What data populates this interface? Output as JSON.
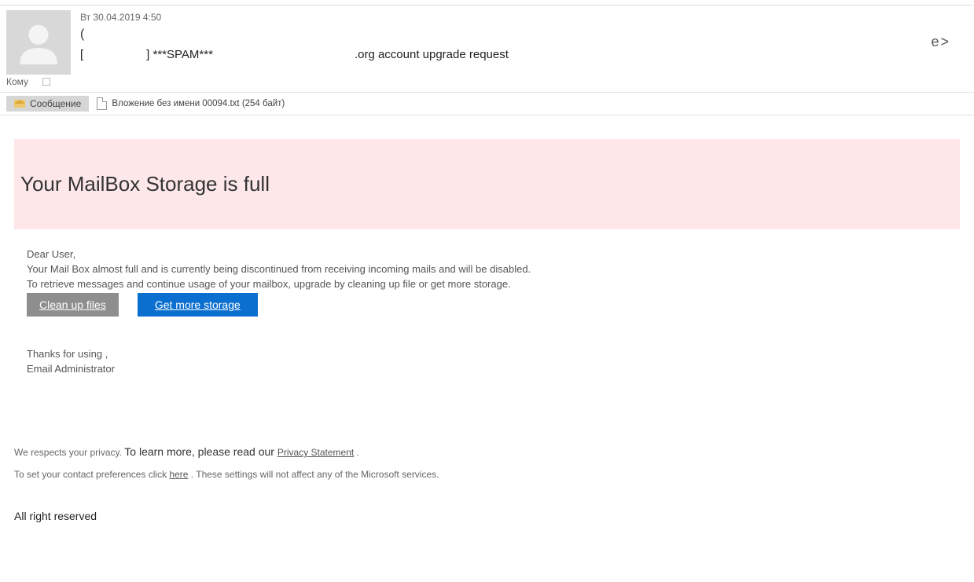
{
  "header": {
    "date": "Вт 30.04.2019 4:50",
    "sender_open": "(",
    "right_text": "e>",
    "subject_left": "[",
    "subject_spam": "] ***SPAM***",
    "subject_right": ".org account upgrade request",
    "to_label": "Кому"
  },
  "tabs": {
    "message_tab": "Сообщение",
    "attachment_name": "Вложение без имени 00094.txt (254 байт)"
  },
  "banner": {
    "title": "Your MailBox Storage is full"
  },
  "body": {
    "greeting": "Dear User,",
    "para1": "Your Mail Box almost full and is currently being discontinued from receiving incoming mails and will be disabled.",
    "para2": "To retrieve messages and continue usage of your mailbox, upgrade by cleaning up file or get more storage.",
    "btn_clean": "Clean up files",
    "btn_get": "Get   more storage",
    "thanks": "Thanks for using ,",
    "admin": "Email Administrator"
  },
  "footer": {
    "respect": "We respects your privacy. ",
    "learn": "To learn more, please read our ",
    "privacy_link": "Privacy Statement",
    "period": " .",
    "pref_pre": "To set your contact preferences click ",
    "here_link": "here",
    "pref_post": " . These settings will not affect any of the Microsoft services.",
    "allright": "All right reserved"
  }
}
